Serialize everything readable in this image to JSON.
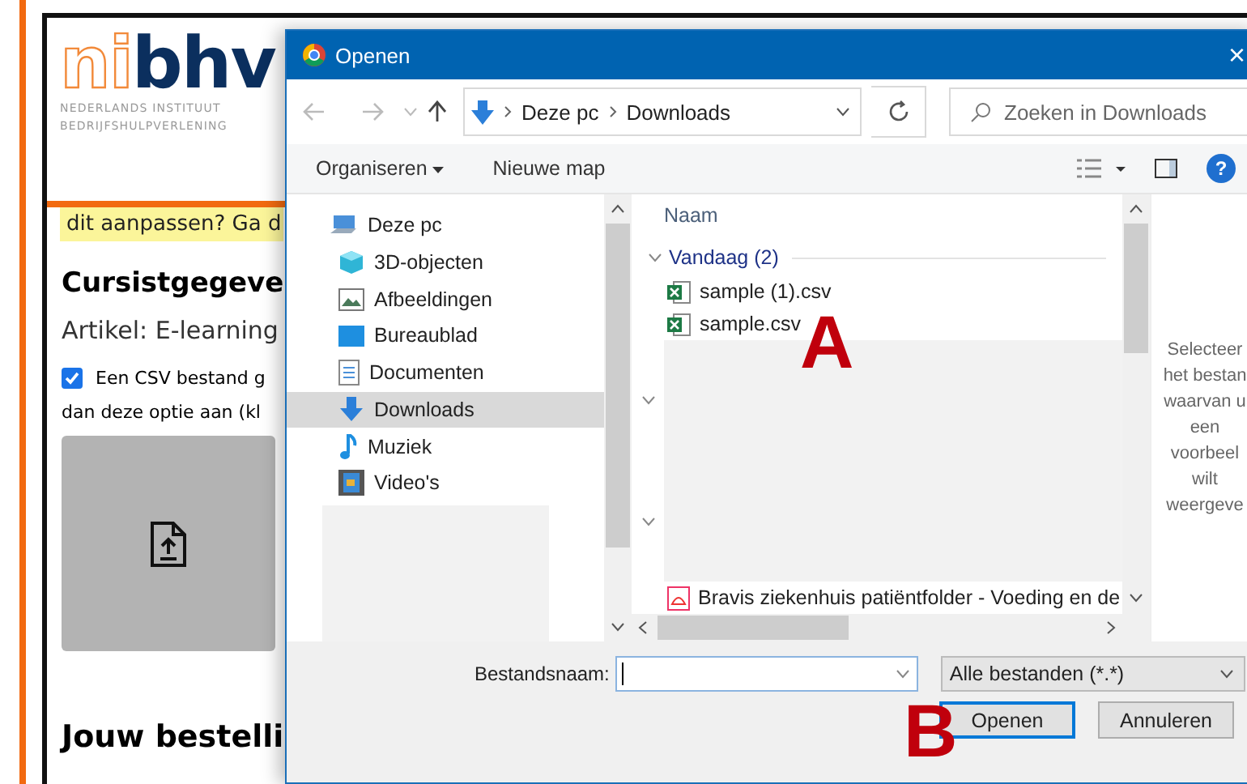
{
  "page": {
    "logo": {
      "text_a": "ni",
      "text_b": "bhv"
    },
    "logo_subtitle": [
      "NEDERLANDS INSTITUUT",
      "BEDRIJFSHULPVERLENING"
    ],
    "notice": "dit aanpassen? Ga d",
    "heading": "Cursistgegeve",
    "article": "Artikel: E-learning",
    "csv_option": {
      "checked": true,
      "line_1": "Een CSV bestand g",
      "line_2": "dan deze optie aan (kl"
    },
    "order_heading": "Jouw bestelli"
  },
  "dialog": {
    "title": "Openen",
    "close": "×",
    "path": [
      "Deze pc",
      "Downloads"
    ],
    "search": {
      "placeholder": "Zoeken in Downloads"
    },
    "toolbar": {
      "organise": "Organiseren",
      "new_folder": "Nieuwe map",
      "help": "?"
    },
    "nav_tree": [
      {
        "label": "Deze pc",
        "selected": false,
        "children": [
          {
            "label": "3D-objecten",
            "selected": false
          },
          {
            "label": "Afbeeldingen",
            "selected": false
          },
          {
            "label": "Bureaublad",
            "selected": false
          },
          {
            "label": "Documenten",
            "selected": false
          },
          {
            "label": "Downloads",
            "selected": true
          },
          {
            "label": "Muziek",
            "selected": false
          },
          {
            "label": "Video's",
            "selected": false
          }
        ]
      }
    ],
    "files": {
      "column": "Naam",
      "group": "Vandaag (2)",
      "items": [
        {
          "name": "sample (1).csv"
        },
        {
          "name": "sample.csv"
        }
      ],
      "lower_items": [
        {
          "name": "Bravis ziekenhuis patiëntfolder - Voeding en de"
        }
      ]
    },
    "preview_hint": [
      "Selecteer",
      "het bestan",
      "waarvan u",
      "een",
      "voorbeel",
      "wilt",
      "weergeve"
    ],
    "filename": {
      "label": "Bestandsnaam:"
    },
    "filter": "Alle bestanden (*.*)",
    "buttons": [
      {
        "label": "Openen",
        "focused": true
      },
      {
        "label": "Annuleren",
        "focused": false
      }
    ]
  },
  "annotations": [
    {
      "text": "A"
    },
    {
      "text": "B"
    }
  ]
}
